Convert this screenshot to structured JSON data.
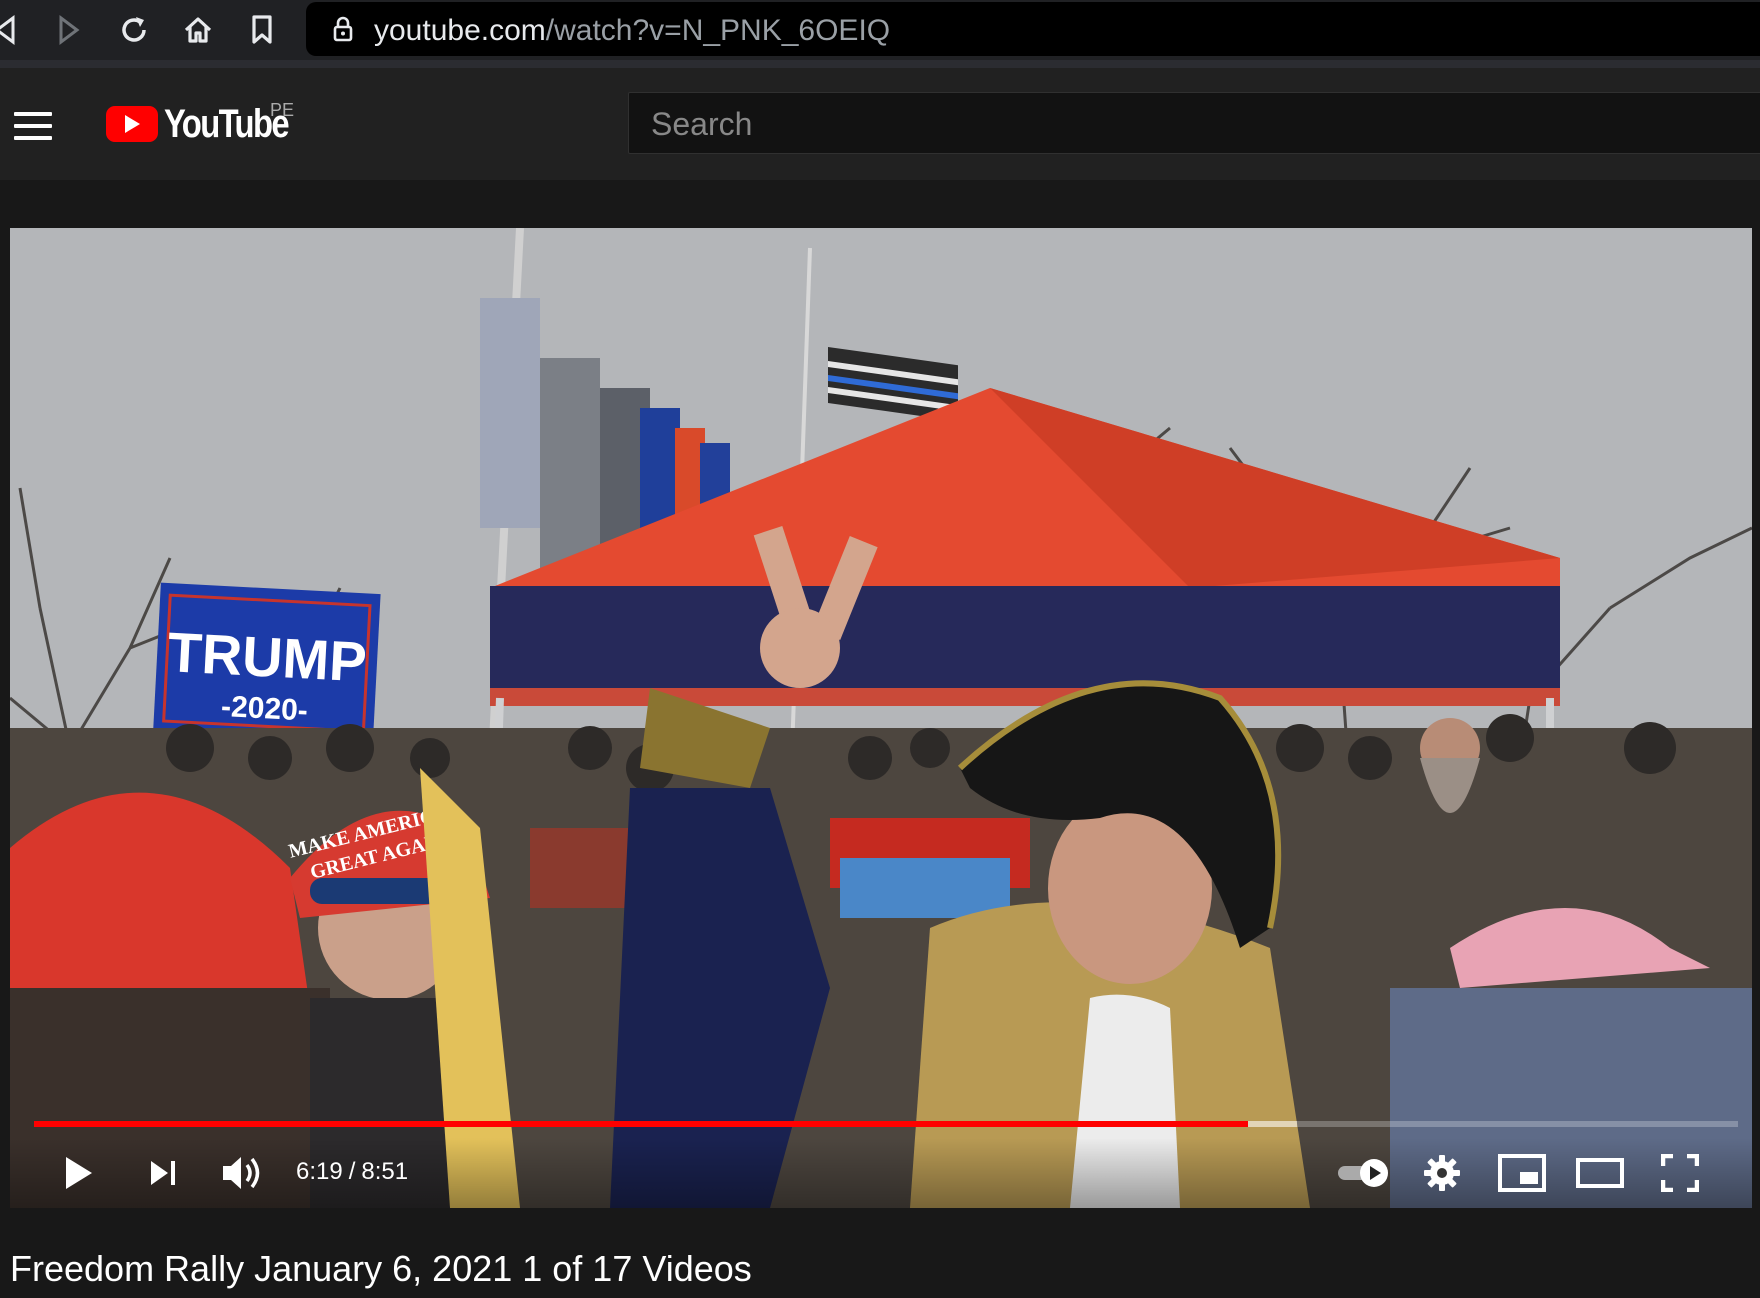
{
  "browser": {
    "url_host": "youtube.com",
    "url_path": "/watch?v=N_PNK_6OEIQ"
  },
  "masthead": {
    "logo_text": "YouTube",
    "country_code": "PE",
    "search_placeholder": "Search"
  },
  "video": {
    "sign_text_main": "TRUMP",
    "sign_text_year": "-2020-",
    "cap_text_line1": "MAKE AMERICA",
    "cap_text_line2": "GREAT AGAIN",
    "progress_fraction": 0.7125,
    "buffered_fraction": 0.7414
  },
  "player_controls": {
    "current_time": "6:19",
    "separator": "/",
    "duration": "8:51"
  },
  "title": "Freedom Rally January 6, 2021 1 of 17 Videos",
  "colors": {
    "progress": "#ff0000",
    "yt_red": "#ff0000"
  }
}
